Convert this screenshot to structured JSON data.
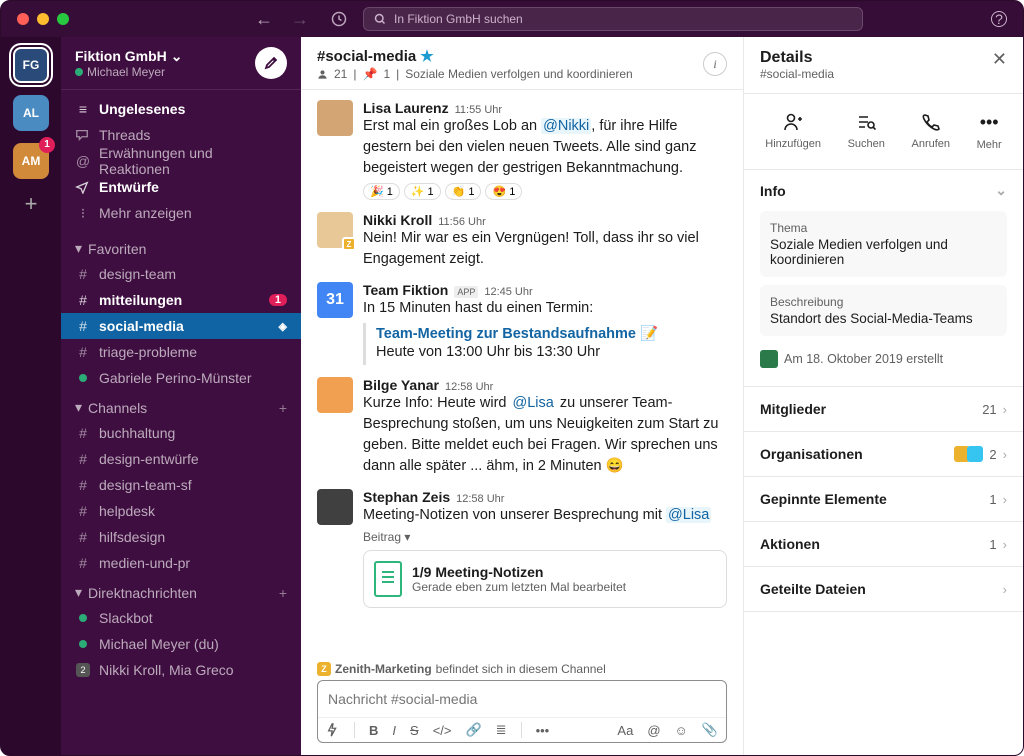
{
  "titlebar": {
    "search_placeholder": "In Fiktion GmbH suchen"
  },
  "rail": {
    "workspaces": [
      {
        "code": "FG",
        "active": true
      },
      {
        "code": "AL"
      },
      {
        "code": "AM",
        "badge": "1"
      }
    ]
  },
  "sidebar": {
    "workspace_name": "Fiktion GmbH",
    "user_name": "Michael Meyer",
    "nav": {
      "unread": "Ungelesenes",
      "threads": "Threads",
      "mentions": "Erwähnungen und Reaktionen",
      "drafts": "Entwürfe",
      "more": "Mehr anzeigen"
    },
    "favorites": {
      "label": "Favoriten",
      "items": [
        {
          "name": "design-team",
          "type": "channel"
        },
        {
          "name": "mitteilungen",
          "type": "channel",
          "bold": true,
          "badge": "1"
        },
        {
          "name": "social-media",
          "type": "channel",
          "active": true
        },
        {
          "name": "triage-probleme",
          "type": "channel"
        },
        {
          "name": "Gabriele Perino-Münster",
          "type": "dm"
        }
      ]
    },
    "channels": {
      "label": "Channels",
      "items": [
        {
          "name": "buchhaltung"
        },
        {
          "name": "design-entwürfe"
        },
        {
          "name": "design-team-sf"
        },
        {
          "name": "helpdesk"
        },
        {
          "name": "hilfsdesign"
        },
        {
          "name": "medien-und-pr"
        }
      ]
    },
    "dms": {
      "label": "Direktnachrichten",
      "items": [
        {
          "name": "Slackbot",
          "presence": true
        },
        {
          "name": "Michael Meyer (du)",
          "presence": true
        },
        {
          "name": "Nikki Kroll, Mia Greco",
          "multi": true,
          "count": "2"
        }
      ]
    }
  },
  "channel": {
    "name": "#social-media",
    "members": "21",
    "pins": "1",
    "topic": "Soziale Medien verfolgen und koordinieren",
    "messages": [
      {
        "author": "Lisa Laurenz",
        "time": "11:55 Uhr",
        "text_pre": "Erst mal ein großes Lob an ",
        "mention": "@Nikki",
        "text_post": ", für ihre Hilfe gestern bei den vielen neuen Tweets. Alle sind ganz begeistert wegen der gestrigen Bekanntmachung.",
        "reactions": [
          {
            "e": "🎉",
            "c": "1"
          },
          {
            "e": "✨",
            "c": "1"
          },
          {
            "e": "👏",
            "c": "1"
          },
          {
            "e": "😍",
            "c": "1"
          }
        ]
      },
      {
        "author": "Nikki Kroll",
        "time": "11:56 Uhr",
        "text": "Nein! Mir war es ein Vergnügen! Toll, dass ihr so viel Engagement zeigt."
      },
      {
        "author": "Team Fiktion",
        "app": "APP",
        "time": "12:45 Uhr",
        "text": "In 15 Minuten hast du einen Termin:",
        "event_title": "Team-Meeting zur Bestandsaufnahme 📝",
        "event_time": "Heute von 13:00 Uhr bis 13:30 Uhr"
      },
      {
        "author": "Bilge Yanar",
        "time": "12:58 Uhr",
        "text_pre": "Kurze Info: Heute wird ",
        "mention": "@Lisa",
        "text_post": " zu unserer Team-Besprechung stoßen, um uns Neuigkeiten zum Start zu geben. Bitte meldet euch bei Fragen. Wir sprechen uns dann alle später ... ähm, in 2 Minuten 😄"
      },
      {
        "author": "Stephan Zeis",
        "time": "12:58 Uhr",
        "text_pre": "Meeting-Notizen von unserer Besprechung mit ",
        "mention": "@Lisa",
        "beitrag": "Beitrag ▾",
        "att_title": "1/9 Meeting-Notizen",
        "att_sub": "Gerade eben zum letzten Mal bearbeitet"
      }
    ],
    "zenith_name": "Zenith-Marketing",
    "zenith_text": " befindet sich in diesem Channel",
    "composer_placeholder": "Nachricht #social-media"
  },
  "details": {
    "title": "Details",
    "sub": "#social-media",
    "actions": {
      "add": "Hinzufügen",
      "search": "Suchen",
      "call": "Anrufen",
      "more": "Mehr"
    },
    "info": {
      "label": "Info",
      "thema_label": "Thema",
      "thema": "Soziale Medien verfolgen und koordinieren",
      "besch_label": "Beschreibung",
      "besch": "Standort des Social-Media-Teams",
      "created": "Am 18. Oktober 2019 erstellt"
    },
    "rows": {
      "members_label": "Mitglieder",
      "members_val": "21",
      "orgs_label": "Organisationen",
      "orgs_val": "2",
      "pins_label": "Gepinnte Elemente",
      "pins_val": "1",
      "actions_label": "Aktionen",
      "actions_val": "1",
      "files_label": "Geteilte Dateien"
    }
  }
}
